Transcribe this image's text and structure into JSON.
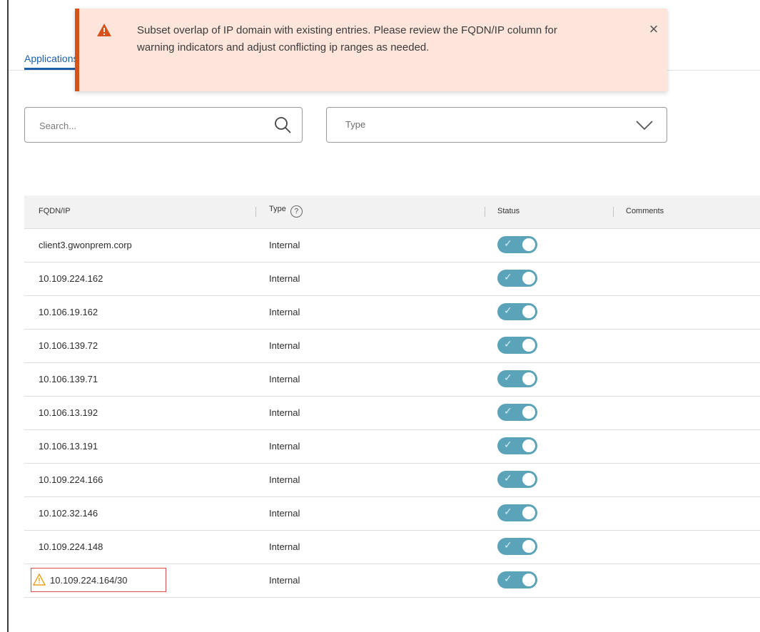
{
  "tabs": {
    "active_label": "Applications"
  },
  "toast": {
    "message": "Subset overlap of IP domain with existing entries. Please review the FQDN/IP column for warning indicators and adjust conflicting ip ranges as needed.",
    "close_glyph": "×",
    "icon": "warning-icon",
    "accent_color": "#d5531a",
    "background_color": "#fde5db"
  },
  "filters": {
    "search_placeholder": "Search...",
    "type_label": "Type"
  },
  "table": {
    "columns": {
      "fqdn": "FQDN/IP",
      "type": "Type",
      "status": "Status",
      "comments": "Comments"
    },
    "type_help_glyph": "?",
    "rows": [
      {
        "fqdn": "client3.gwonprem.corp",
        "type": "Internal",
        "status": "on",
        "comments": "",
        "warning": false
      },
      {
        "fqdn": "10.109.224.162",
        "type": "Internal",
        "status": "on",
        "comments": "",
        "warning": false
      },
      {
        "fqdn": "10.106.19.162",
        "type": "Internal",
        "status": "on",
        "comments": "",
        "warning": false
      },
      {
        "fqdn": "10.106.139.72",
        "type": "Internal",
        "status": "on",
        "comments": "",
        "warning": false
      },
      {
        "fqdn": "10.106.139.71",
        "type": "Internal",
        "status": "on",
        "comments": "",
        "warning": false
      },
      {
        "fqdn": "10.106.13.192",
        "type": "Internal",
        "status": "on",
        "comments": "",
        "warning": false
      },
      {
        "fqdn": "10.106.13.191",
        "type": "Internal",
        "status": "on",
        "comments": "",
        "warning": false
      },
      {
        "fqdn": "10.109.224.166",
        "type": "Internal",
        "status": "on",
        "comments": "",
        "warning": false
      },
      {
        "fqdn": "10.102.32.146",
        "type": "Internal",
        "status": "on",
        "comments": "",
        "warning": false
      },
      {
        "fqdn": "10.109.224.148",
        "type": "Internal",
        "status": "on",
        "comments": "",
        "warning": false
      },
      {
        "fqdn": "10.109.224.164/30",
        "type": "Internal",
        "status": "on",
        "comments": "",
        "warning": true
      }
    ],
    "toggle_check_glyph": "✓",
    "toggle_color": "#5aa3b8",
    "warning_color": "#e8a317",
    "warning_highlight_color": "#d94c4c"
  }
}
